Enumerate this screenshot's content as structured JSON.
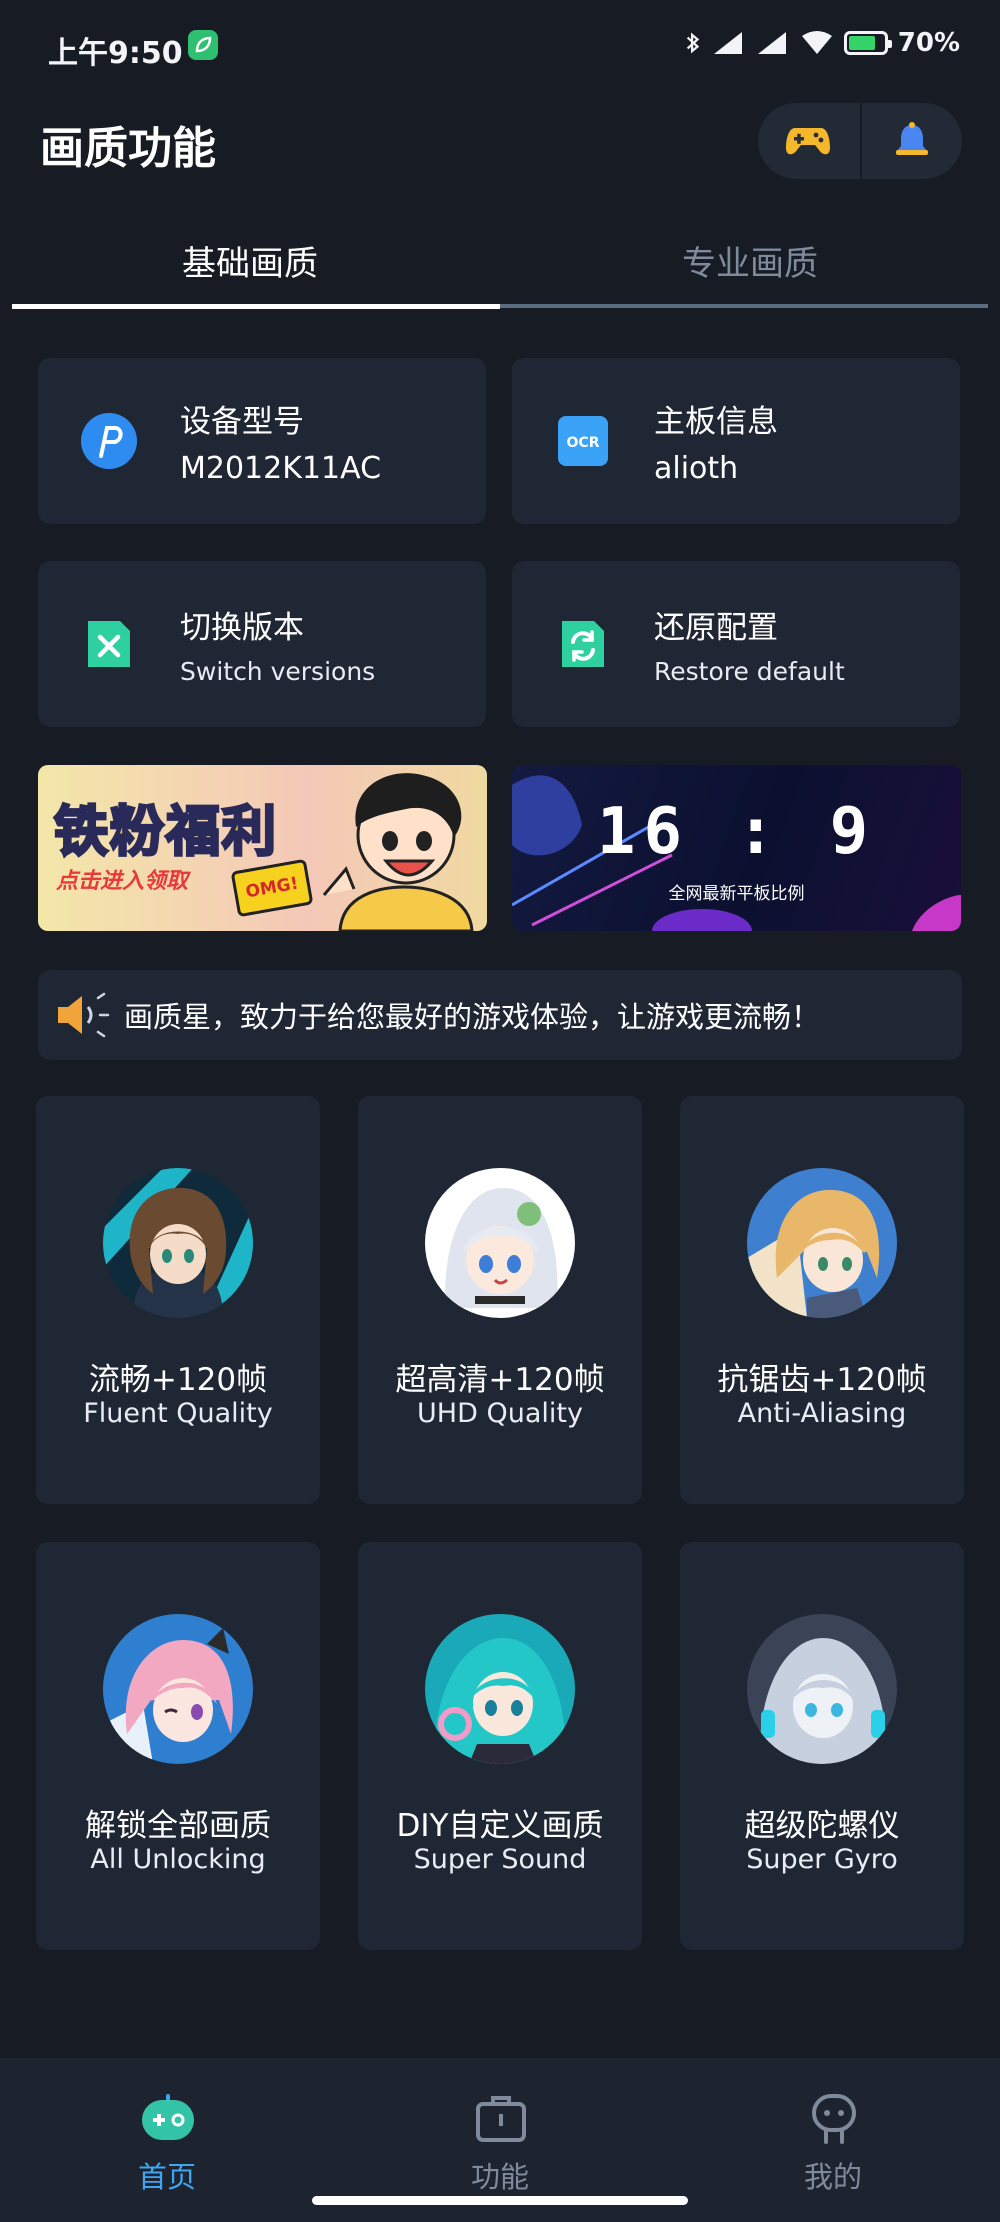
{
  "status_bar": {
    "time": "上午9:50",
    "battery": "70%"
  },
  "header": {
    "title": "画质功能"
  },
  "tabs": [
    {
      "label": "基础画质"
    },
    {
      "label": "专业画质"
    }
  ],
  "info_cards": [
    {
      "title": "设备型号",
      "value": "M2012K11AC",
      "icon": "p-logo-icon"
    },
    {
      "title": "主板信息",
      "value": "alioth",
      "icon": "ocr-icon"
    },
    {
      "title": "切换版本",
      "value": "Switch versions",
      "icon": "switch-x-icon"
    },
    {
      "title": "还原配置",
      "value": "Restore default",
      "icon": "restore-icon"
    }
  ],
  "banners": [
    {
      "title": "铁粉福利",
      "subtitle": "点击进入领取",
      "badge": "OMG!"
    },
    {
      "title": "16 : 9",
      "subtitle": "全网最新平板比例"
    }
  ],
  "notice": {
    "text": "画质星，致力于给您最好的游戏体验，让游戏更流畅！"
  },
  "features": [
    {
      "title": "流畅+120帧",
      "subtitle": "Fluent Quality"
    },
    {
      "title": "超高清+120帧",
      "subtitle": "UHD Quality"
    },
    {
      "title": "抗锯齿+120帧",
      "subtitle": "Anti-Aliasing"
    },
    {
      "title": "解锁全部画质",
      "subtitle": "All Unlocking"
    },
    {
      "title": "DIY自定义画质",
      "subtitle": "Super Sound"
    },
    {
      "title": "超级陀螺仪",
      "subtitle": "Super Gyro"
    }
  ],
  "bottom_nav": [
    {
      "label": "首页",
      "active": true
    },
    {
      "label": "功能",
      "active": false
    },
    {
      "label": "我的",
      "active": false
    }
  ],
  "colors": {
    "background": "#161b24",
    "card": "#202734",
    "accent": "#3ea6f5",
    "inactive": "#7f8b9c"
  }
}
